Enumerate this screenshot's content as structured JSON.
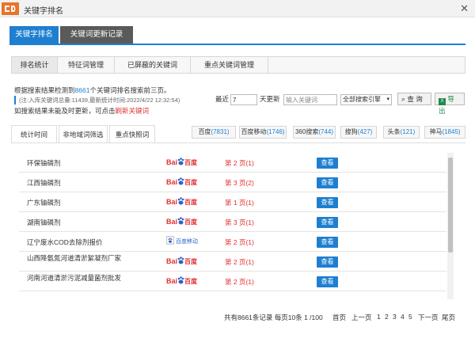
{
  "window": {
    "title": "关键字排名"
  },
  "main_tabs": [
    "关键字排名",
    "关键词更新记录"
  ],
  "sub_tabs": [
    "排名统计",
    "特征词管理",
    "已屏蔽的关键词",
    "重点关键词管理"
  ],
  "summary": {
    "line1_prefix": "根据搜索结果检测到",
    "line1_count": "8661",
    "line1_suffix": "个关键词排名搜索前三页。",
    "line2": "(注:入库关键词总量:11439,最新统计时间:2022/4/22 12:32:54)",
    "line3_prefix": "如搜索结果未能及时更新，可点击",
    "line3_link": "刷新关键词"
  },
  "filter": {
    "recent_label": "最近",
    "days_value": "7",
    "days_suffix": "天更新",
    "keyword_placeholder": "输入关键词",
    "engine_select": "全部搜索引擎",
    "query_button": "查 询",
    "export_button": "导出"
  },
  "stat_tabs": [
    "统计时间",
    "非地域词筛选",
    "重点快照词"
  ],
  "engines": [
    {
      "name": "百度",
      "count": "(7831)"
    },
    {
      "name": "百度移动",
      "count": "(1746)"
    },
    {
      "name": "360搜索",
      "count": "(744)"
    },
    {
      "name": "搜狗",
      "count": "(427)"
    },
    {
      "name": "头条",
      "count": "(121)"
    },
    {
      "name": "神马",
      "count": "(1845)"
    }
  ],
  "engine_logos": {
    "baidu_text1": "Bai",
    "baidu_text2": "百度",
    "baidu_mobile_text": "百度移动"
  },
  "rows": [
    {
      "keyword": "环保铀磷剂",
      "engine": "baidu",
      "rank": "第 2 页(1)",
      "action": "查看"
    },
    {
      "keyword": "江西铀磷剂",
      "engine": "baidu",
      "rank": "第 3 页(2)",
      "action": "查看"
    },
    {
      "keyword": "广东铀磷剂",
      "engine": "baidu",
      "rank": "第 1 页(1)",
      "action": "查看"
    },
    {
      "keyword": "湖南铀磷剂",
      "engine": "baidu",
      "rank": "第 3 页(1)",
      "action": "查看"
    },
    {
      "keyword": "辽宁废水COD去除剂报价",
      "engine": "baidu_mobile",
      "rank": "第 2 页(1)",
      "action": "查看"
    },
    {
      "keyword": "山西降氨氮河道清淤絮凝剂厂家",
      "engine": "baidu",
      "rank": "第 2 页(1)",
      "action": "查看"
    },
    {
      "keyword": "河南河道清淤污泥减量菌剂批发",
      "engine": "baidu",
      "rank": "第 2 页(1)",
      "action": "查看"
    }
  ],
  "pagination": {
    "summary": "共有8661条记录 每页10条 1 /100",
    "first": "首页",
    "prev": "上一页",
    "pages": [
      "1",
      "2",
      "3",
      "4",
      "5"
    ],
    "current": "1",
    "next": "下一页",
    "last": "尾页"
  },
  "colors": {
    "accent": "#1e7fd1",
    "alert": "#e03030",
    "dark_tab": "#5a5a5a"
  }
}
